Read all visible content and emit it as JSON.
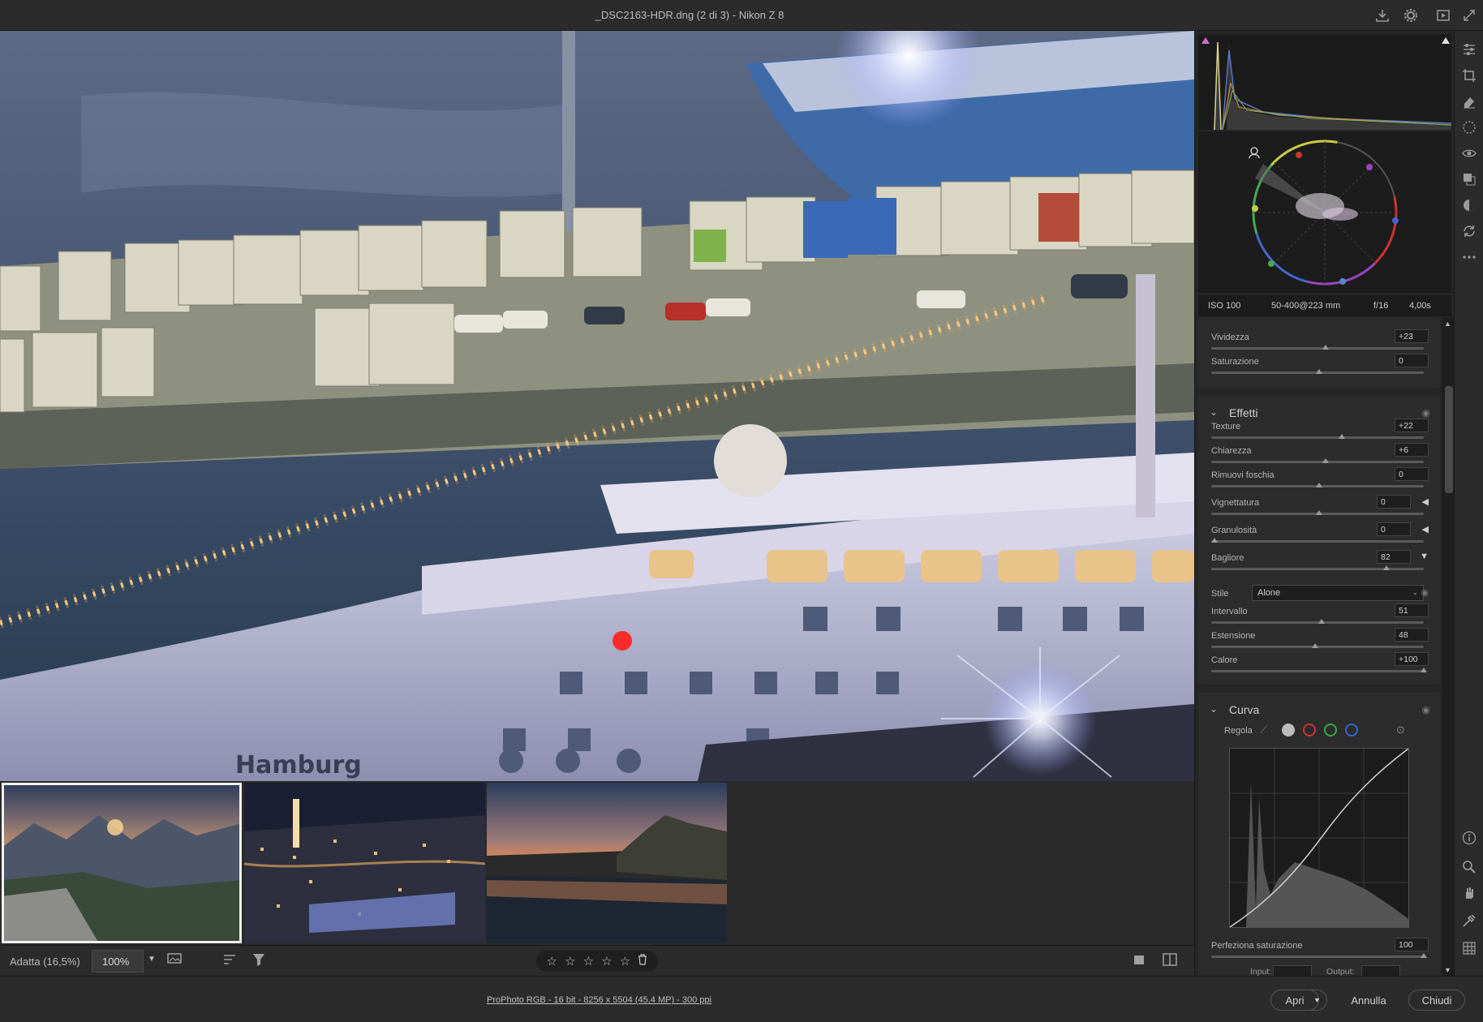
{
  "title": "_DSC2163-HDR.dng (2 di 3)  -  Nikon Z 8",
  "viewer": {
    "fit_label": "Adatta (16,5%)",
    "zoom_value": "100%",
    "ship_name": "Hamburg"
  },
  "stars": [
    "☆",
    "☆",
    "☆",
    "☆",
    "☆"
  ],
  "status": {
    "file_info": "ProPhoto RGB - 16 bit - 8256 x 5504 (45,4 MP) - 300 ppi",
    "open_label": "Apri",
    "cancel_label": "Annulla",
    "close_label": "Chiudi"
  },
  "exif": {
    "iso": "ISO 100",
    "lens": "50-400@223 mm",
    "aperture": "f/16",
    "shutter": "4,00s"
  },
  "sliders_top": [
    {
      "label": "Vividezza",
      "value": "+23",
      "pos": 0.53
    },
    {
      "label": "Saturazione",
      "value": "0",
      "pos": 0.5
    }
  ],
  "effetti": {
    "title": "Effetti",
    "sliders": [
      {
        "label": "Texture",
        "value": "+22",
        "pos": 0.61
      },
      {
        "label": "Chiarezza",
        "value": "+6",
        "pos": 0.53
      },
      {
        "label": "Rimuovi foschia",
        "value": "0",
        "pos": 0.5
      },
      {
        "label": "Vignettatura",
        "value": "0",
        "pos": 0.5
      },
      {
        "label": "Granulosità",
        "value": "0",
        "pos": 0.0
      },
      {
        "label": "Bagliore",
        "value": "82",
        "pos": 0.82
      }
    ],
    "stile_label": "Stile",
    "stile_value": "Alone",
    "sub_sliders": [
      {
        "label": "Intervallo",
        "value": "51",
        "pos": 0.51
      },
      {
        "label": "Estensione",
        "value": "48",
        "pos": 0.48
      },
      {
        "label": "Calore",
        "value": "+100",
        "pos": 1.0
      }
    ]
  },
  "curva": {
    "title": "Curva",
    "regola_label": "Regola",
    "perfeziona_label": "Perfeziona saturazione",
    "perfeziona_value": "100",
    "input_label": "Input:",
    "output_label": "Output:"
  }
}
